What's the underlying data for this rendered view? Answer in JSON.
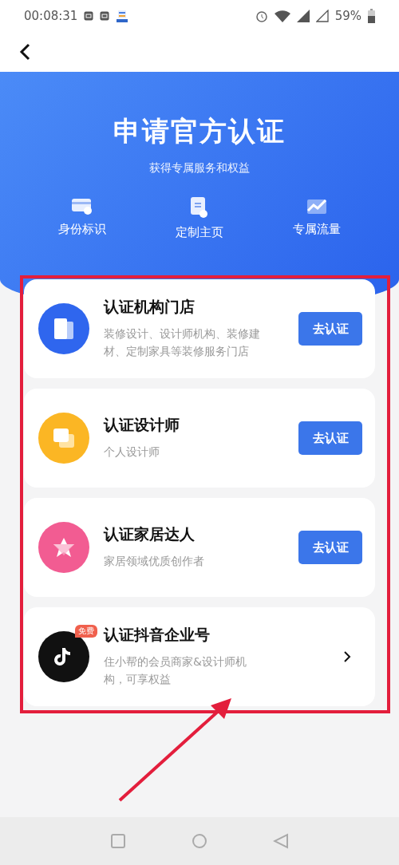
{
  "status_bar": {
    "time": "00:08:31",
    "battery": "59%"
  },
  "hero": {
    "title": "申请官方认证",
    "subtitle": "获得专属服务和权益",
    "features": [
      {
        "kind": "card",
        "label": "身份标识"
      },
      {
        "kind": "page",
        "label": "定制主页"
      },
      {
        "kind": "trend",
        "label": "专属流量"
      }
    ]
  },
  "options": [
    {
      "kind": "button",
      "color": "#2f66ee",
      "title": "认证机构门店",
      "description": "装修设计、设计师机构、装修建材、定制家具等装修服务门店",
      "action": "去认证"
    },
    {
      "kind": "button",
      "color": "#fbb624",
      "title": "认证设计师",
      "description": "个人设计师",
      "action": "去认证"
    },
    {
      "kind": "button",
      "color": "#f25c92",
      "title": "认证家居达人",
      "description": "家居领域优质创作者",
      "action": "去认证"
    },
    {
      "kind": "chevron",
      "color": "#111111",
      "badge": "免费",
      "title": "认证抖音企业号",
      "description": "住小帮的会员商家&设计师机构，可享权益"
    }
  ]
}
